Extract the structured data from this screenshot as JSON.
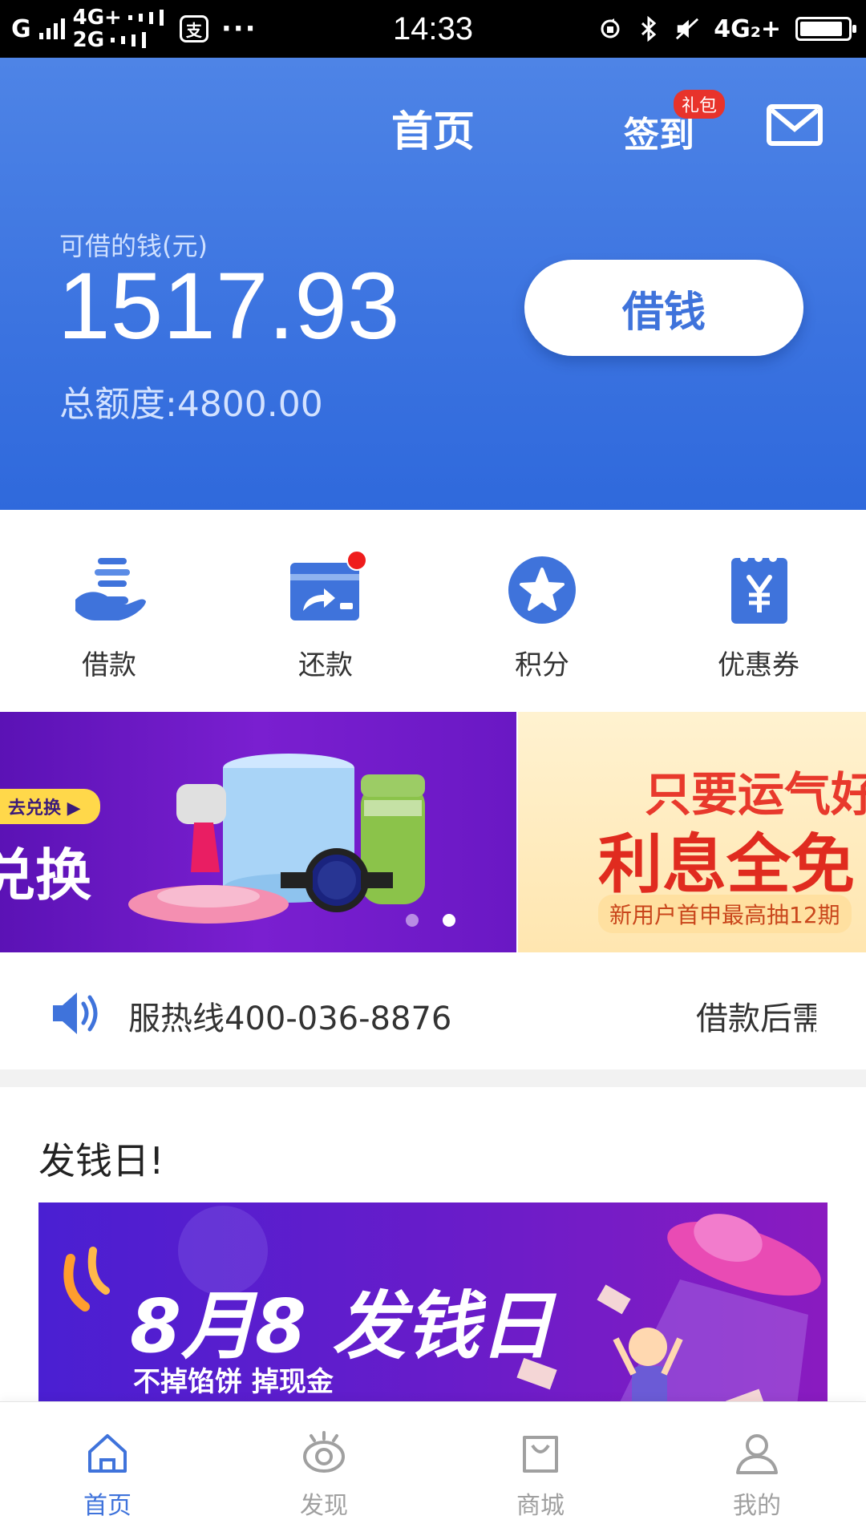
{
  "status_bar": {
    "net1": "G",
    "net2": "4G+",
    "net3": "2G",
    "app_icon": "支",
    "dots": "···",
    "time": "14:33",
    "net4": "4G₂+",
    "battery_level": 0.9
  },
  "header": {
    "title": "首页",
    "checkin_label": "签到",
    "gift_badge": "礼包",
    "available_label": "可借的钱(元)",
    "available_amount": "1517.93",
    "total_limit": "总额度:4800.00",
    "borrow_button": "借钱"
  },
  "actions": [
    {
      "label": "借款",
      "icon": "hand-coins-icon"
    },
    {
      "label": "还款",
      "icon": "repay-card-icon"
    },
    {
      "label": "积分",
      "icon": "star-points-icon"
    },
    {
      "label": "优惠券",
      "icon": "coupon-yen-icon"
    }
  ],
  "banners": {
    "banner1_pill": "去兑换 ▶",
    "banner1_text": "兑换",
    "banner2_line1": "只要运气好",
    "banner2_line2": "利息全免",
    "banner2_sub": "新用户首申最高抽12期"
  },
  "notice": {
    "text1": "服热线400-036-8876",
    "text2": "借款后需"
  },
  "promo": {
    "section_title": "发钱日!",
    "title": "8月8 发钱日",
    "subtitle": "不掉馅饼 掉现金"
  },
  "bottom_nav": [
    {
      "label": "首页",
      "active": true
    },
    {
      "label": "发现",
      "active": false
    },
    {
      "label": "商城",
      "active": false
    },
    {
      "label": "我的",
      "active": false
    }
  ],
  "colors": {
    "primary": "#3f73db",
    "header_top": "#4e84e6",
    "badge_red": "#e8332b",
    "inactive": "#a0a0a0"
  }
}
